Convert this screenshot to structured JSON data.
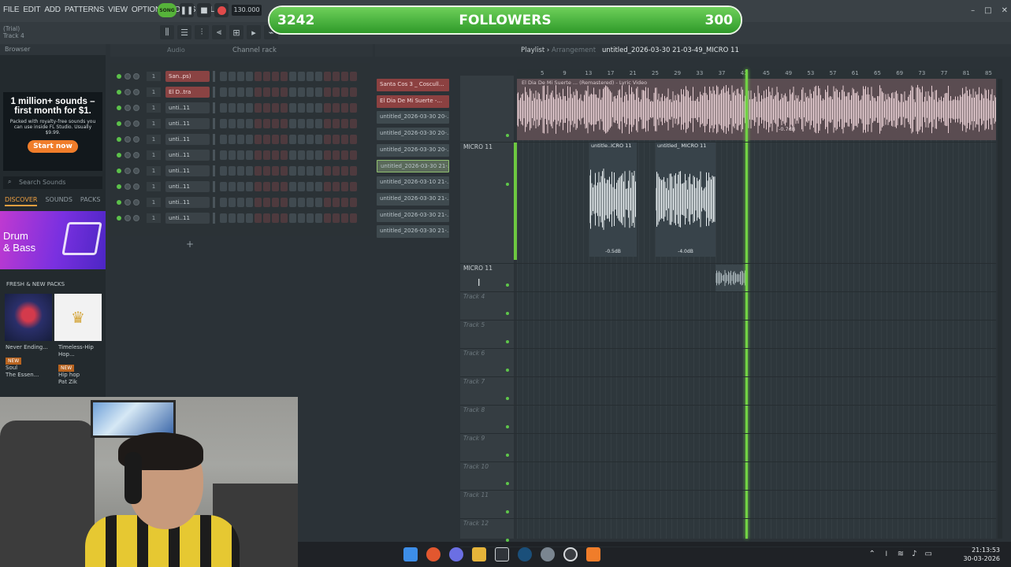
{
  "menu": [
    "FILE",
    "EDIT",
    "ADD",
    "PATTERNS",
    "VIEW",
    "OPTIONS",
    "TOOLS",
    "HELP"
  ],
  "hint": {
    "line1": "(Trial)",
    "line2": "Track 4"
  },
  "transport": {
    "mode": "SONG",
    "tempo": "130.000"
  },
  "followers": {
    "left": "3242",
    "label": "FOLLOWERS",
    "right": "300",
    "progress_pct": 100
  },
  "browser": {
    "title": "Browser",
    "ad_title": "1 million+ sounds – first month for $1.",
    "ad_text": "Packed with royalty-free sounds you can use inside FL Studio. Usually $9.99.",
    "ad_button": "Start now",
    "search_placeholder": "Search Sounds",
    "tabs": [
      "DISCOVER",
      "SOUNDS",
      "PACKS"
    ],
    "banner": "Drum\n& Bass",
    "fresh": "FRESH & NEW PACKS",
    "packs": [
      {
        "name": "Never Ending...",
        "badge": "NEW",
        "genre": "Soul",
        "author": "The Essen..."
      },
      {
        "name": "Timeless-Hip Hop...",
        "badge": "NEW",
        "genre": "Hip hop",
        "author": "Pat Zik"
      }
    ]
  },
  "rack": {
    "title": "Channel rack",
    "tab": "Audio",
    "channels": [
      {
        "num": "1",
        "name": "San..ps)",
        "red": true
      },
      {
        "num": "1",
        "name": "El D..tra",
        "red": true
      },
      {
        "num": "1",
        "name": "unti..11",
        "red": false
      },
      {
        "num": "1",
        "name": "unti..11",
        "red": false
      },
      {
        "num": "1",
        "name": "unti..11",
        "red": false
      },
      {
        "num": "1",
        "name": "unti..11",
        "red": false
      },
      {
        "num": "1",
        "name": "unti..11",
        "red": false
      },
      {
        "num": "1",
        "name": "unti..11",
        "red": false
      },
      {
        "num": "1",
        "name": "unti..11",
        "red": false
      },
      {
        "num": "1",
        "name": "unti..11",
        "red": false
      }
    ]
  },
  "picker": [
    {
      "label": "Santa Cos 3 _ Coscull...",
      "style": "red"
    },
    {
      "label": "El Dia De Mi Suerte -...",
      "style": "red"
    },
    {
      "label": "untitled_2026-03-30 20-...",
      "style": "normal"
    },
    {
      "label": "untitled_2026-03-30 20-...",
      "style": "normal"
    },
    {
      "label": "untitled_2026-03-30 20-...",
      "style": "normal"
    },
    {
      "label": "untitled_2026-03-30 21-...",
      "style": "sel"
    },
    {
      "label": "untitled_2026-03-10 21-...",
      "style": "normal"
    },
    {
      "label": "untitled_2026-03-30 21-...",
      "style": "normal"
    },
    {
      "label": "untitled_2026-03-30 21-...",
      "style": "normal"
    },
    {
      "label": "untitled_2026-03-30 21-...",
      "style": "normal"
    }
  ],
  "playlist": {
    "title": "Playlist",
    "subtitle": "Arrangement",
    "project": "untitled_2026-03-30 21-03-49_MICRO 11",
    "ruler": [
      "5",
      "9",
      "13",
      "17",
      "21",
      "25",
      "29",
      "33",
      "37",
      "41",
      "45",
      "49",
      "53",
      "57",
      "61",
      "65",
      "69",
      "73",
      "77",
      "81",
      "85"
    ],
    "tracks": [
      {
        "label": "",
        "bright": true
      },
      {
        "label": "MICRO 11",
        "bright": true
      },
      {
        "label": "MICRO 11",
        "bright": true
      },
      {
        "label": "Track 4",
        "bright": false
      },
      {
        "label": "Track 5",
        "bright": false
      },
      {
        "label": "Track 6",
        "bright": false
      },
      {
        "label": "Track 7",
        "bright": false
      },
      {
        "label": "Track 8",
        "bright": false
      },
      {
        "label": "Track 9",
        "bright": false
      },
      {
        "label": "Track 10",
        "bright": false
      },
      {
        "label": "Track 11",
        "bright": false
      },
      {
        "label": "Track 12",
        "bright": false
      }
    ],
    "clip1": {
      "label": "El Dia De Mi Suerte ... (Remastered) - Lyric Video",
      "db": "-0.7dB"
    },
    "clip2": {
      "label": "untitle..ICRO 11",
      "db": "-0.5dB"
    },
    "clip3": {
      "label": "untitled_ MICRO 11",
      "db": "-4.0dB"
    }
  },
  "clock": {
    "time": "21:13:53",
    "date": "30-03-2026"
  },
  "colors": {
    "accent": "#f07d2a",
    "playhead": "#72d245",
    "red_clip": "#8c4141"
  }
}
